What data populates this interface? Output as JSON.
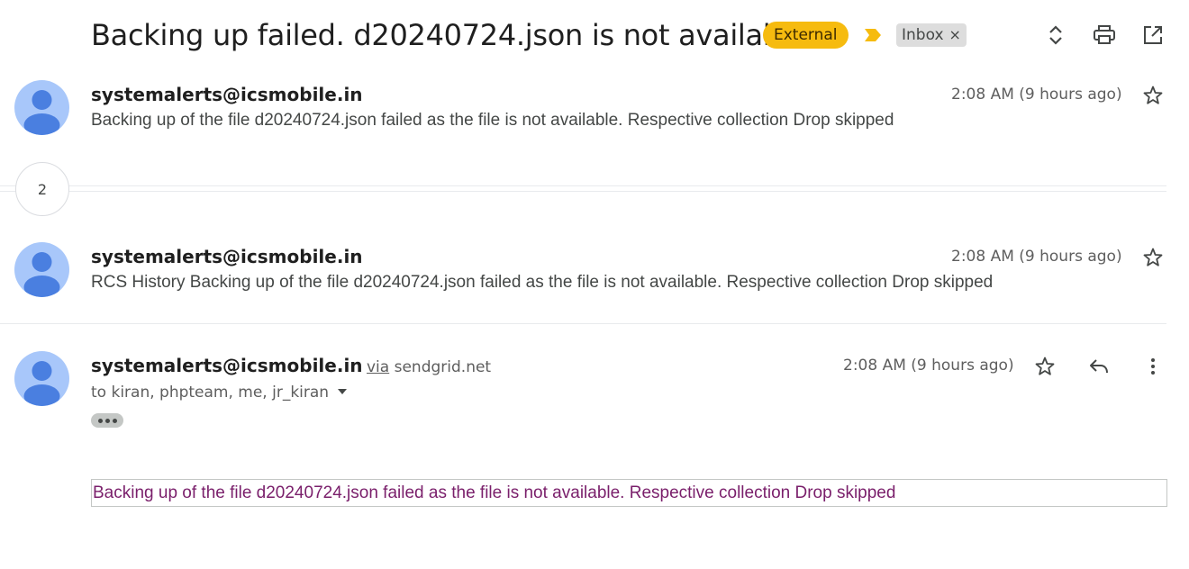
{
  "header": {
    "subject": "Backing up failed. d20240724.json is not available",
    "external_label": "External",
    "inbox_label": "Inbox",
    "inbox_remove": "×"
  },
  "thread": {
    "collapsed_count": "2",
    "messages": [
      {
        "sender": "systemalerts@icsmobile.in",
        "time": "2:08 AM (9 hours ago)",
        "snippet": "Backing up of the file d20240724.json failed as the file is not available. Respective collection Drop skipped"
      },
      {
        "sender": "systemalerts@icsmobile.in",
        "time": "2:08 AM (9 hours ago)",
        "snippet": "RCS History Backing up of the file d20240724.json failed as the file is not available. Respective collection Drop skipped"
      },
      {
        "sender": "systemalerts@icsmobile.in",
        "via_word": "via",
        "via_domain": "sendgrid.net",
        "time": "2:08 AM (9 hours ago)",
        "recipients": "to kiran, phpteam, me, jr_kiran",
        "body": "Backing up of the file d20240724.json failed as the file is not available. Respective collection Drop skipped"
      }
    ]
  },
  "icons": {
    "expand": "unfold-icon",
    "print": "print-icon",
    "popout": "open-in-new-icon",
    "star": "star-outline-icon",
    "reply": "reply-icon",
    "more": "more-vert-icon",
    "label_marker": "important-marker-icon",
    "dropdown": "caret-down-icon"
  },
  "colors": {
    "external_badge": "#f6bb0f",
    "important_marker": "#f6bb0f",
    "avatar_bg": "#a8c7fa",
    "avatar_fg": "#4a7fe0",
    "body_text": "#7a1f6b"
  }
}
